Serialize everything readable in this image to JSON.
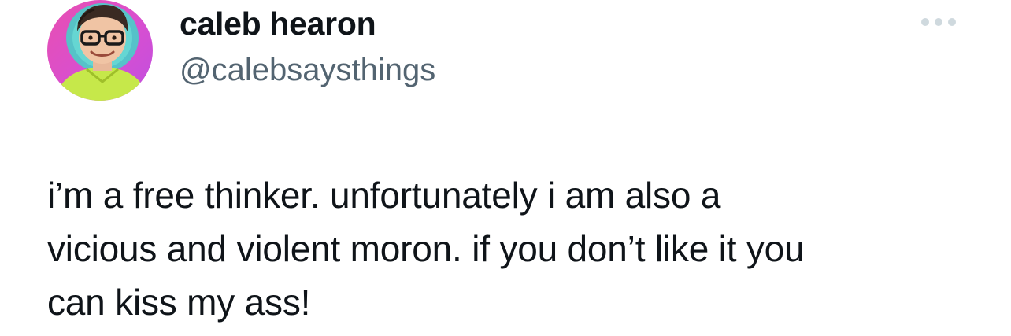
{
  "author": {
    "name": "caleb hearon",
    "handle": "@calebsaysthings",
    "avatar_icon": "user-avatar-photo"
  },
  "more_icon": "more-horizontal-icon",
  "tweet": {
    "lines": [
      "i’m a free thinker. unfortunately i am also a",
      "vicious and violent moron. if you don’t like it you",
      "can kiss my ass!"
    ]
  },
  "colors": {
    "text": "#0f1419",
    "secondary": "#536471",
    "more_dots": "#cfd9de",
    "avatar_bg_pink": "#e94fb0",
    "avatar_bg_teal": "#3ed6c8",
    "avatar_shirt": "#c6e84a"
  }
}
